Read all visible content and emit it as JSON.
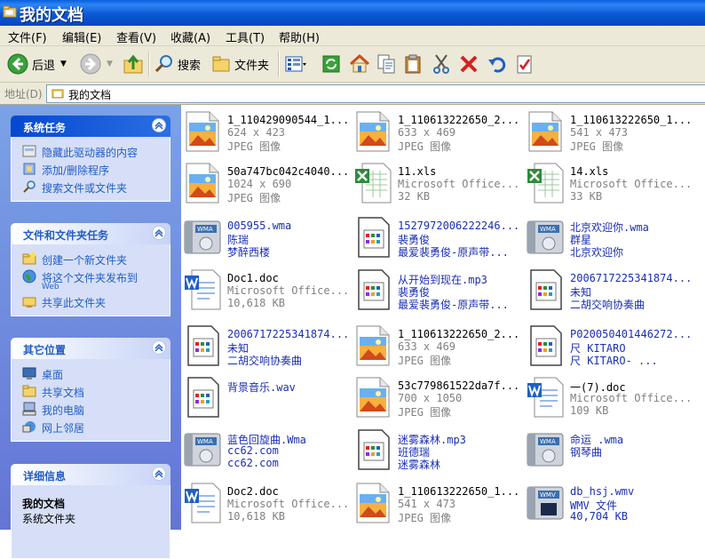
{
  "window": {
    "title": "我的文档"
  },
  "menu": [
    "文件(F)",
    "编辑(E)",
    "查看(V)",
    "收藏(A)",
    "工具(T)",
    "帮助(H)"
  ],
  "toolbar": {
    "back": "后退",
    "search": "搜索",
    "folders": "文件夹"
  },
  "address": {
    "label": "地址(D)",
    "value": "我的文档"
  },
  "panels": {
    "system_tasks": {
      "title": "系统任务",
      "items": [
        "隐藏此驱动器的内容",
        "添加/删除程序",
        "搜索文件或文件夹"
      ]
    },
    "file_tasks": {
      "title": "文件和文件夹任务",
      "items": [
        "创建一个新文件夹",
        "将这个文件夹发布到",
        "Web",
        "共享此文件夹"
      ]
    },
    "other_places": {
      "title": "其它位置",
      "items": [
        "桌面",
        "共享文档",
        "我的电脑",
        "网上邻居"
      ]
    },
    "details": {
      "title": "详细信息",
      "name": "我的文档",
      "type": "系统文件夹"
    }
  },
  "files": [
    {
      "icon": "jpeg-image-icon",
      "line1": "1_110429090544_1...",
      "line2": "624 x 423",
      "line3": "JPEG 图像"
    },
    {
      "icon": "jpeg-image-icon",
      "line1": "1_110613222650_2...",
      "line2": "633 x 469",
      "line3": "JPEG 图像"
    },
    {
      "icon": "jpeg-image-icon",
      "line1": "1_110613222650_1...",
      "line2": "541 x 473",
      "line3": "JPEG 图像"
    },
    {
      "icon": "jpeg-image-icon",
      "line1": "50a747bc042c4040...",
      "line2": "1024 x 690",
      "line3": "JPEG 图像"
    },
    {
      "icon": "excel-file-icon",
      "line1": "11.xls",
      "line2": "Microsoft Office...",
      "line3": "32 KB"
    },
    {
      "icon": "excel-file-icon",
      "line1": "14.xls",
      "line2": "Microsoft Office...",
      "line3": "33 KB"
    },
    {
      "icon": "wma-audio-icon",
      "line1": "005955.wma",
      "line2": "陈瑞",
      "line3": "梦醉西楼"
    },
    {
      "icon": "audio-file-icon",
      "line1": "1527972006222246...",
      "line2": "裴勇俊",
      "line3": "最爱裴勇俊-原声带..."
    },
    {
      "icon": "wma-audio-icon",
      "line1": "北京欢迎你.wma",
      "line2": "群星",
      "line3": "北京欢迎你"
    },
    {
      "icon": "word-doc-icon",
      "line1": "Doc1.doc",
      "line2": "Microsoft Office...",
      "line3": "10,618 KB"
    },
    {
      "icon": "audio-file-icon",
      "line1": "从开始到现在.mp3",
      "line2": "裴勇俊",
      "line3": "最爱裴勇俊-原声带..."
    },
    {
      "icon": "audio-file-icon",
      "line1": "2006717225341874...",
      "line2": "未知",
      "line3": "二胡交响协奏曲"
    },
    {
      "icon": "audio-file-icon",
      "line1": "2006717225341874...",
      "line2": "未知",
      "line3": "二胡交响协奏曲"
    },
    {
      "icon": "jpeg-image-icon",
      "line1": "1_110613222650_2...",
      "line2": "633 x 469",
      "line3": "JPEG 图像"
    },
    {
      "icon": "audio-file-icon",
      "line1": "P020050401446272...",
      "line2": "尺    KITARO",
      "line3": "尺    KITARO-    ..."
    },
    {
      "icon": "audio-file-icon",
      "line1": "背景音乐.wav",
      "line2": "",
      "line3": ""
    },
    {
      "icon": "jpeg-image-icon",
      "line1": "53c779861522da7f...",
      "line2": "700 x 1050",
      "line3": "JPEG 图像"
    },
    {
      "icon": "word-doc-icon",
      "line1": "一(7).doc",
      "line2": "Microsoft Office...",
      "line3": "109 KB"
    },
    {
      "icon": "wma-audio-icon",
      "line1": "蓝色回旋曲.Wma",
      "line2": "cc62.com",
      "line3": "cc62.com"
    },
    {
      "icon": "audio-file-icon",
      "line1": "迷雾森林.mp3",
      "line2": "班德瑞",
      "line3": "迷雾森林"
    },
    {
      "icon": "wma-audio-icon",
      "line1": "命运 .wma",
      "line2": "钢琴曲",
      "line3": ""
    },
    {
      "icon": "word-doc-icon",
      "line1": "Doc2.doc",
      "line2": "Microsoft Office...",
      "line3": "10,618 KB"
    },
    {
      "icon": "jpeg-image-icon",
      "line1": "1_110613222650_1...",
      "line2": "541 x 473",
      "line3": "JPEG 图像"
    },
    {
      "icon": "wmv-video-icon",
      "line1": "db_hsj.wmv",
      "line2": "WMV 文件",
      "line3": "40,704 KB"
    }
  ]
}
